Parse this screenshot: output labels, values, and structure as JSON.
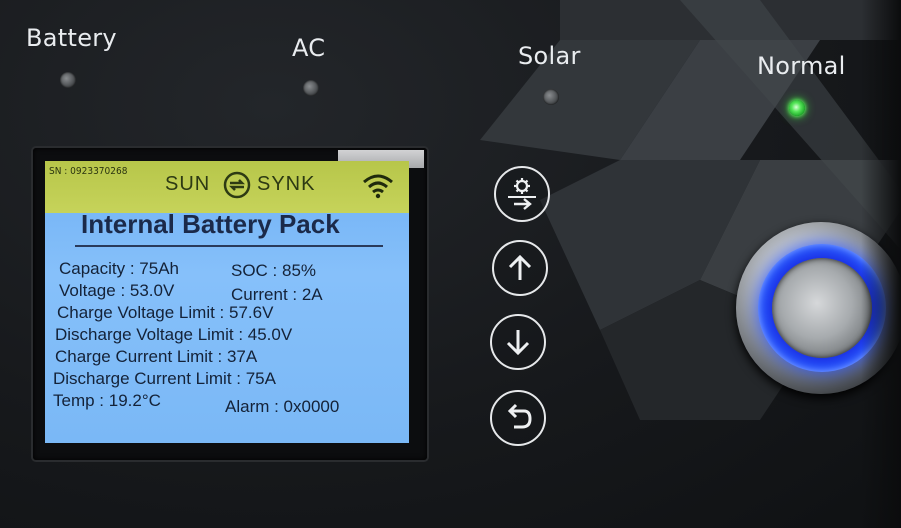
{
  "indicators": [
    {
      "label": "Battery",
      "state": "off"
    },
    {
      "label": "AC",
      "state": "off"
    },
    {
      "label": "Solar",
      "state": "off"
    },
    {
      "label": "Normal",
      "state": "on",
      "color": "#3cff3c"
    }
  ],
  "lcd": {
    "serial": "SN : 0923370268",
    "brand_left": "SUN",
    "brand_right": "SYNK",
    "title": "Internal Battery Pack",
    "rows": [
      {
        "text": "Capacity : 75Ah"
      },
      {
        "text": "SOC : 85%"
      },
      {
        "text": "Voltage : 53.0V"
      },
      {
        "text": "Current : 2A"
      },
      {
        "text": "Charge Voltage Limit : 57.6V"
      },
      {
        "text": "Discharge Voltage Limit : 45.0V"
      },
      {
        "text": "Charge Current Limit : 37A"
      },
      {
        "text": "Discharge Current Limit : 75A"
      },
      {
        "text": "Temp : 19.2°C"
      },
      {
        "text": "Alarm : 0x0000"
      }
    ],
    "colors": {
      "screen": "#7ab8f6",
      "header": "#c0cd55",
      "text": "#142238"
    }
  },
  "buttons": [
    {
      "name": "settings-enter",
      "icon": "gear-arrow-icon"
    },
    {
      "name": "up",
      "icon": "arrow-up-icon"
    },
    {
      "name": "down",
      "icon": "arrow-down-icon"
    },
    {
      "name": "back",
      "icon": "return-icon"
    }
  ],
  "power_button": {
    "ring_color": "#2a49ff"
  }
}
